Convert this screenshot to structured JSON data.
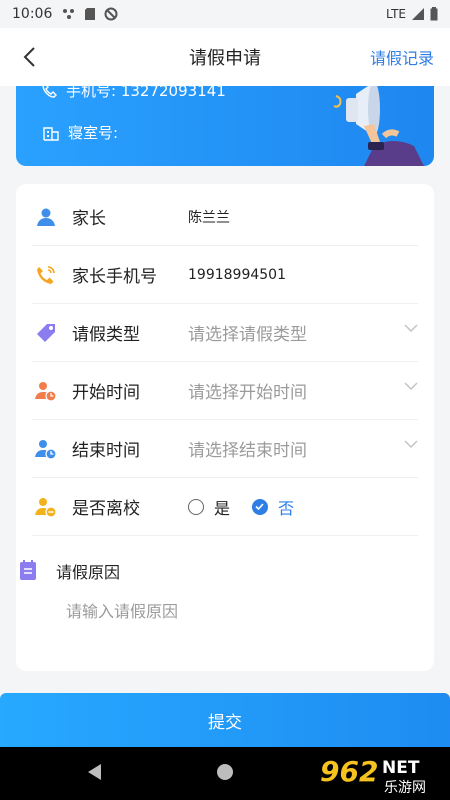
{
  "status": {
    "time": "10:06",
    "network": "LTE"
  },
  "nav": {
    "title": "请假申请",
    "record": "请假记录"
  },
  "banner": {
    "phone": "手机号: 13272093141",
    "dorm": "寝室号:"
  },
  "form": {
    "parent": {
      "label": "家长",
      "value": "陈兰兰"
    },
    "parent_phone": {
      "label": "家长手机号",
      "value": "19918994501"
    },
    "leave_type": {
      "label": "请假类型",
      "placeholder": "请选择请假类型"
    },
    "start_time": {
      "label": "开始时间",
      "placeholder": "请选择开始时间"
    },
    "end_time": {
      "label": "结束时间",
      "placeholder": "请选择结束时间"
    },
    "leave_school": {
      "label": "是否离校",
      "yes": "是",
      "no": "否",
      "selected": "否"
    },
    "reason": {
      "label": "请假原因",
      "placeholder": "请输入请假原因"
    }
  },
  "submit_label": "提交",
  "watermark": {
    "logo_text": "962",
    "domain": "NET",
    "site": "乐游网"
  },
  "colors": {
    "accent": "#2f7ee6",
    "banner": "#2aa1ff"
  }
}
